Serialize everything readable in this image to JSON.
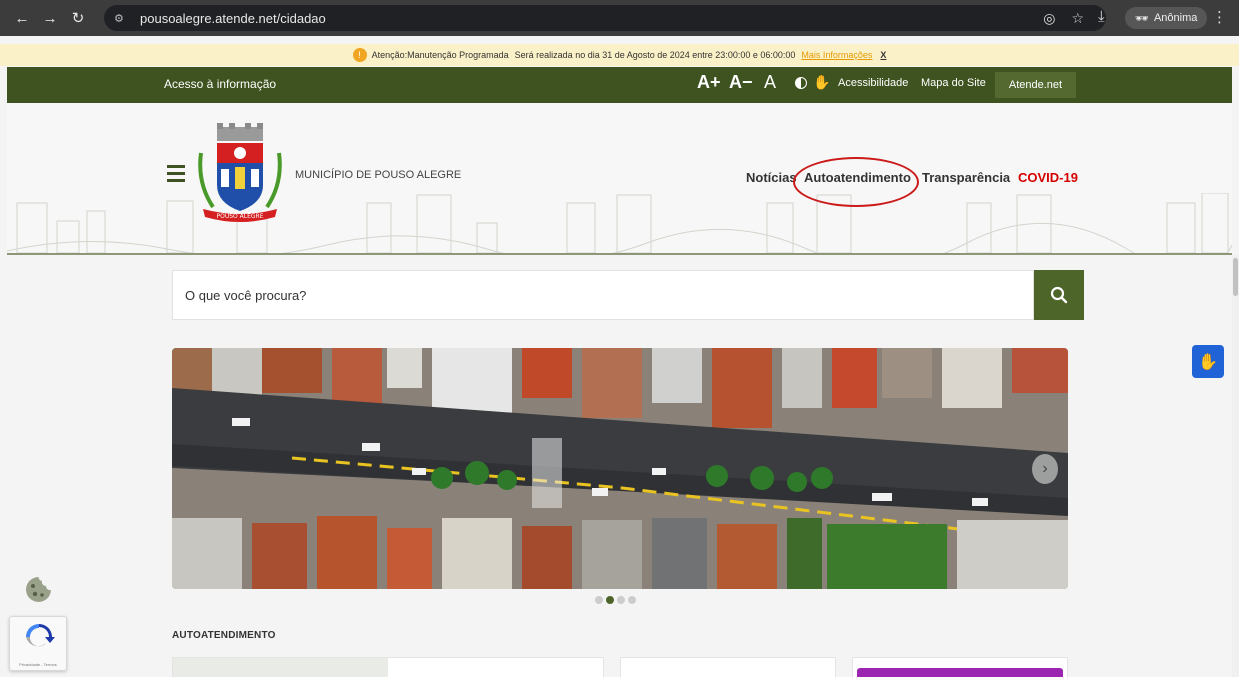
{
  "browser": {
    "url": "pousoalegre.atende.net/cidadao",
    "incognito_label": "Anônima"
  },
  "notice": {
    "title": "Atenção:Manutenção Programada",
    "text": "Será realizada no dia 31 de Agosto de 2024 entre 23:00:00 e 06:00:00",
    "link": "Mais Informações",
    "close": "X"
  },
  "topbar": {
    "access_info": "Acesso à informação",
    "font_increase": "A+",
    "font_decrease": "A−",
    "font_reset": "A",
    "accessibility": "Acessibilidade",
    "sitemap": "Mapa do Site",
    "atende": "Atende.net"
  },
  "header": {
    "municipality": "MUNICÍPIO DE POUSO ALEGRE",
    "crest_ribbon": "POUSO ALEGRE",
    "nav": {
      "news": "Notícias",
      "self_service": "Autoatendimento",
      "transparency": "Transparência",
      "covid": "COVID-19"
    }
  },
  "search": {
    "placeholder": "O que você procura?"
  },
  "carousel": {
    "slide_count": 4,
    "active_index": 1
  },
  "section": {
    "title": "AUTOATENDIMENTO"
  },
  "recaptcha": {
    "footer": "Privacidade - Termos"
  },
  "colors": {
    "brand_green": "#3f5320",
    "covid_red": "#d40000",
    "annotation_red": "#cc1a1a",
    "libras_blue": "#1f63d6",
    "card_purple": "#9b27b0"
  }
}
